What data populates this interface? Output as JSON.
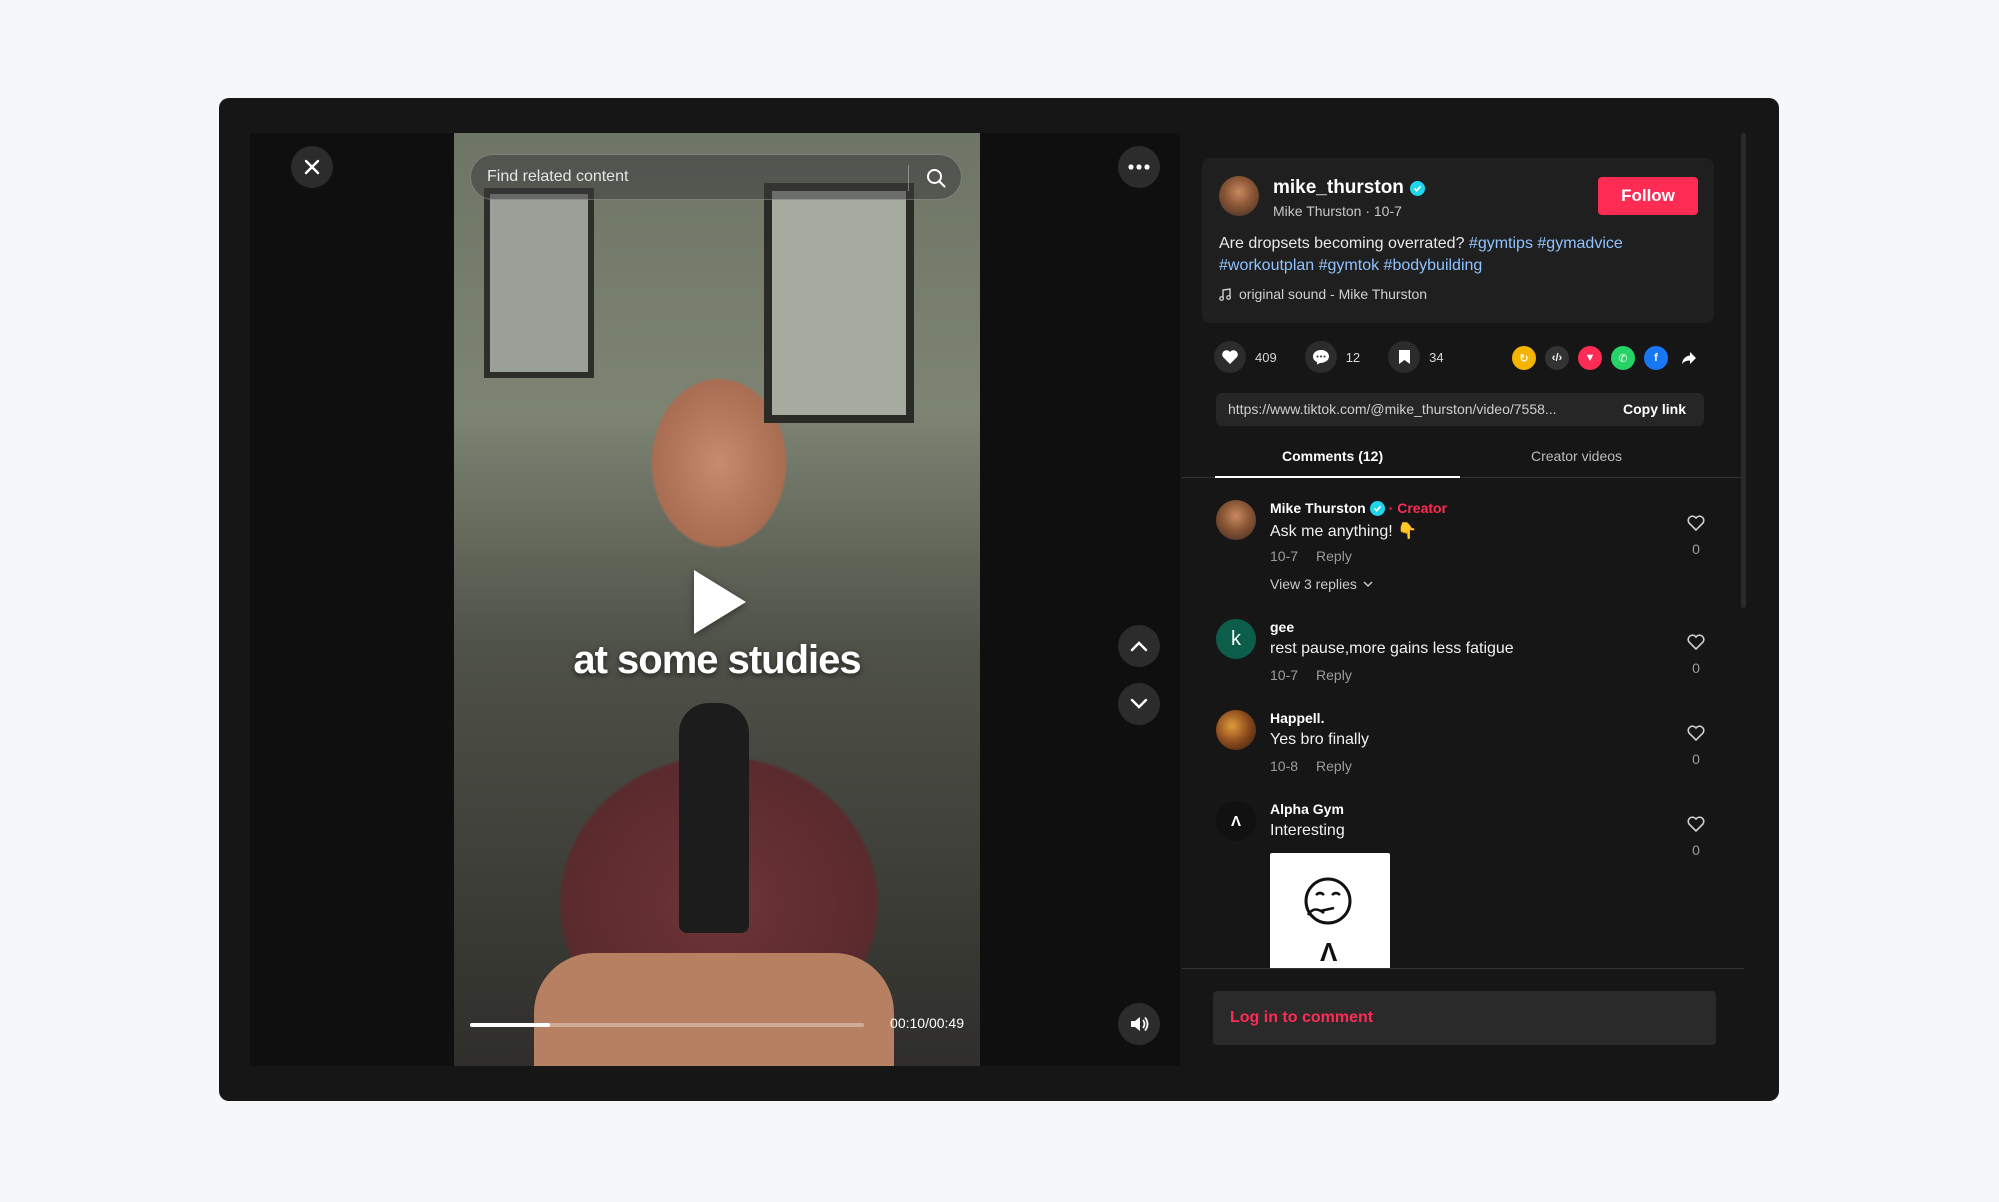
{
  "search": {
    "placeholder": "Find related content"
  },
  "video": {
    "caption": "at some studies",
    "progress_fraction": 0.204,
    "time": "00:10/00:49"
  },
  "author": {
    "username": "mike_thurston",
    "subline": "Mike Thurston · 10-7",
    "follow_label": "Follow",
    "desc_text": "Are dropsets becoming overrated? ",
    "tags": [
      "#gymtips",
      "#gymadvice",
      "#workoutplan",
      "#gymtok",
      "#bodybuilding"
    ],
    "sound": "original sound - Mike Thurston"
  },
  "stats": {
    "likes": "409",
    "comments": "12",
    "saves": "34"
  },
  "share_icons": [
    "repost-icon",
    "embed-icon",
    "send-icon",
    "whatsapp-icon",
    "facebook-icon",
    "share-arrow-icon"
  ],
  "link": {
    "url": "https://www.tiktok.com/@mike_thurston/video/7558...",
    "copy_label": "Copy link"
  },
  "tabs": {
    "comments": "Comments (12)",
    "creator": "Creator videos"
  },
  "comments": [
    {
      "name": "Mike Thurston",
      "creator_label": "· Creator",
      "text": "Ask me anything! 👇",
      "date": "10-7",
      "reply": "Reply",
      "likes": "0",
      "view_replies": "View 3 replies"
    },
    {
      "name": "gee",
      "avatar_letter": "k",
      "text": "rest pause,more gains less fatigue",
      "date": "10-7",
      "reply": "Reply",
      "likes": "0"
    },
    {
      "name": "Happell.",
      "text": "Yes bro finally",
      "date": "10-8",
      "reply": "Reply",
      "likes": "0"
    },
    {
      "name": "Alpha Gym",
      "avatar_letter": "Λ",
      "text": "Interesting",
      "likes": "0",
      "sticker_letter": "Λ"
    }
  ],
  "login_label": "Log in to comment",
  "colors": {
    "accent": "#fe2c55",
    "tag": "#8fc2ff",
    "verified": "#20d5ec"
  }
}
